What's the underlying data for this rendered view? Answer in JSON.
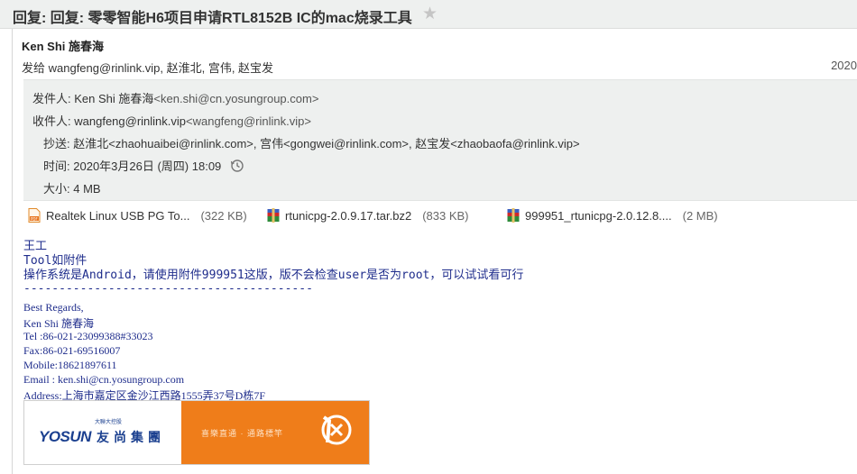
{
  "subject": "回复: 回复: 零零智能H6项目申请RTL8152B IC的mac烧录工具",
  "sender_name": "Ken Shi 施春海",
  "sent_to": "发给 wangfeng@rinlink.vip, 赵淮北, 宫伟, 赵宝发",
  "year": "2020",
  "details": {
    "from_label": "发件人:",
    "from_name": "Ken Shi 施春海",
    "from_email": "<ken.shi@cn.yosungroup.com>",
    "to_label": "收件人:",
    "to_name": "wangfeng@rinlink.vip",
    "to_email": "<wangfeng@rinlink.vip>",
    "cc_label": "抄送:",
    "cc_value": "赵淮北<zhaohuaibei@rinlink.com>, 宫伟<gongwei@rinlink.com>, 赵宝发<zhaobaofa@rinlink.vip>",
    "time_label": "时间:",
    "time_value": "2020年3月26日 (周四) 18:09",
    "size_label": "大小:",
    "size_value": "4 MB"
  },
  "attachments": [
    {
      "name": "Realtek Linux USB PG To...",
      "size": "(322 KB)",
      "icon": "pdf-icon"
    },
    {
      "name": "rtunicpg-2.0.9.17.tar.bz2",
      "size": "(833 KB)",
      "icon": "winrar-icon"
    },
    {
      "name": "999951_rtunicpg-2.0.12.8....",
      "size": "(2 MB)",
      "icon": "winrar-icon"
    }
  ],
  "body": {
    "line1": "王工",
    "line2": "Tool如附件",
    "line3": "操作系统是Android，请使用附件999951这版，版不会检查user是否为root，可以试试看可行",
    "divider": "-----------------------------------------"
  },
  "signature": {
    "regards": "Best Regards,",
    "name": "Ken Shi 施春海",
    "tel": "Tel :86-021-23099388#33023",
    "fax": "Fax:86-021-69516007",
    "mobile": "Mobile:18621897611",
    "email": "Email : ken.shi@cn.yosungroup.com",
    "address": "Address:上海市嘉定区金沙江西路1555弄37号D栋7F"
  },
  "banner": {
    "logo_en": "YOSUN",
    "logo_cn": "友尚集團",
    "logo_small": "大聯大控股",
    "slogan": "喜樂直通 · 通路標竿"
  },
  "colors": {
    "body_text": "#1f2d8c",
    "banner_orange": "#ef7d1a",
    "logo_blue": "#1a3f8f"
  }
}
